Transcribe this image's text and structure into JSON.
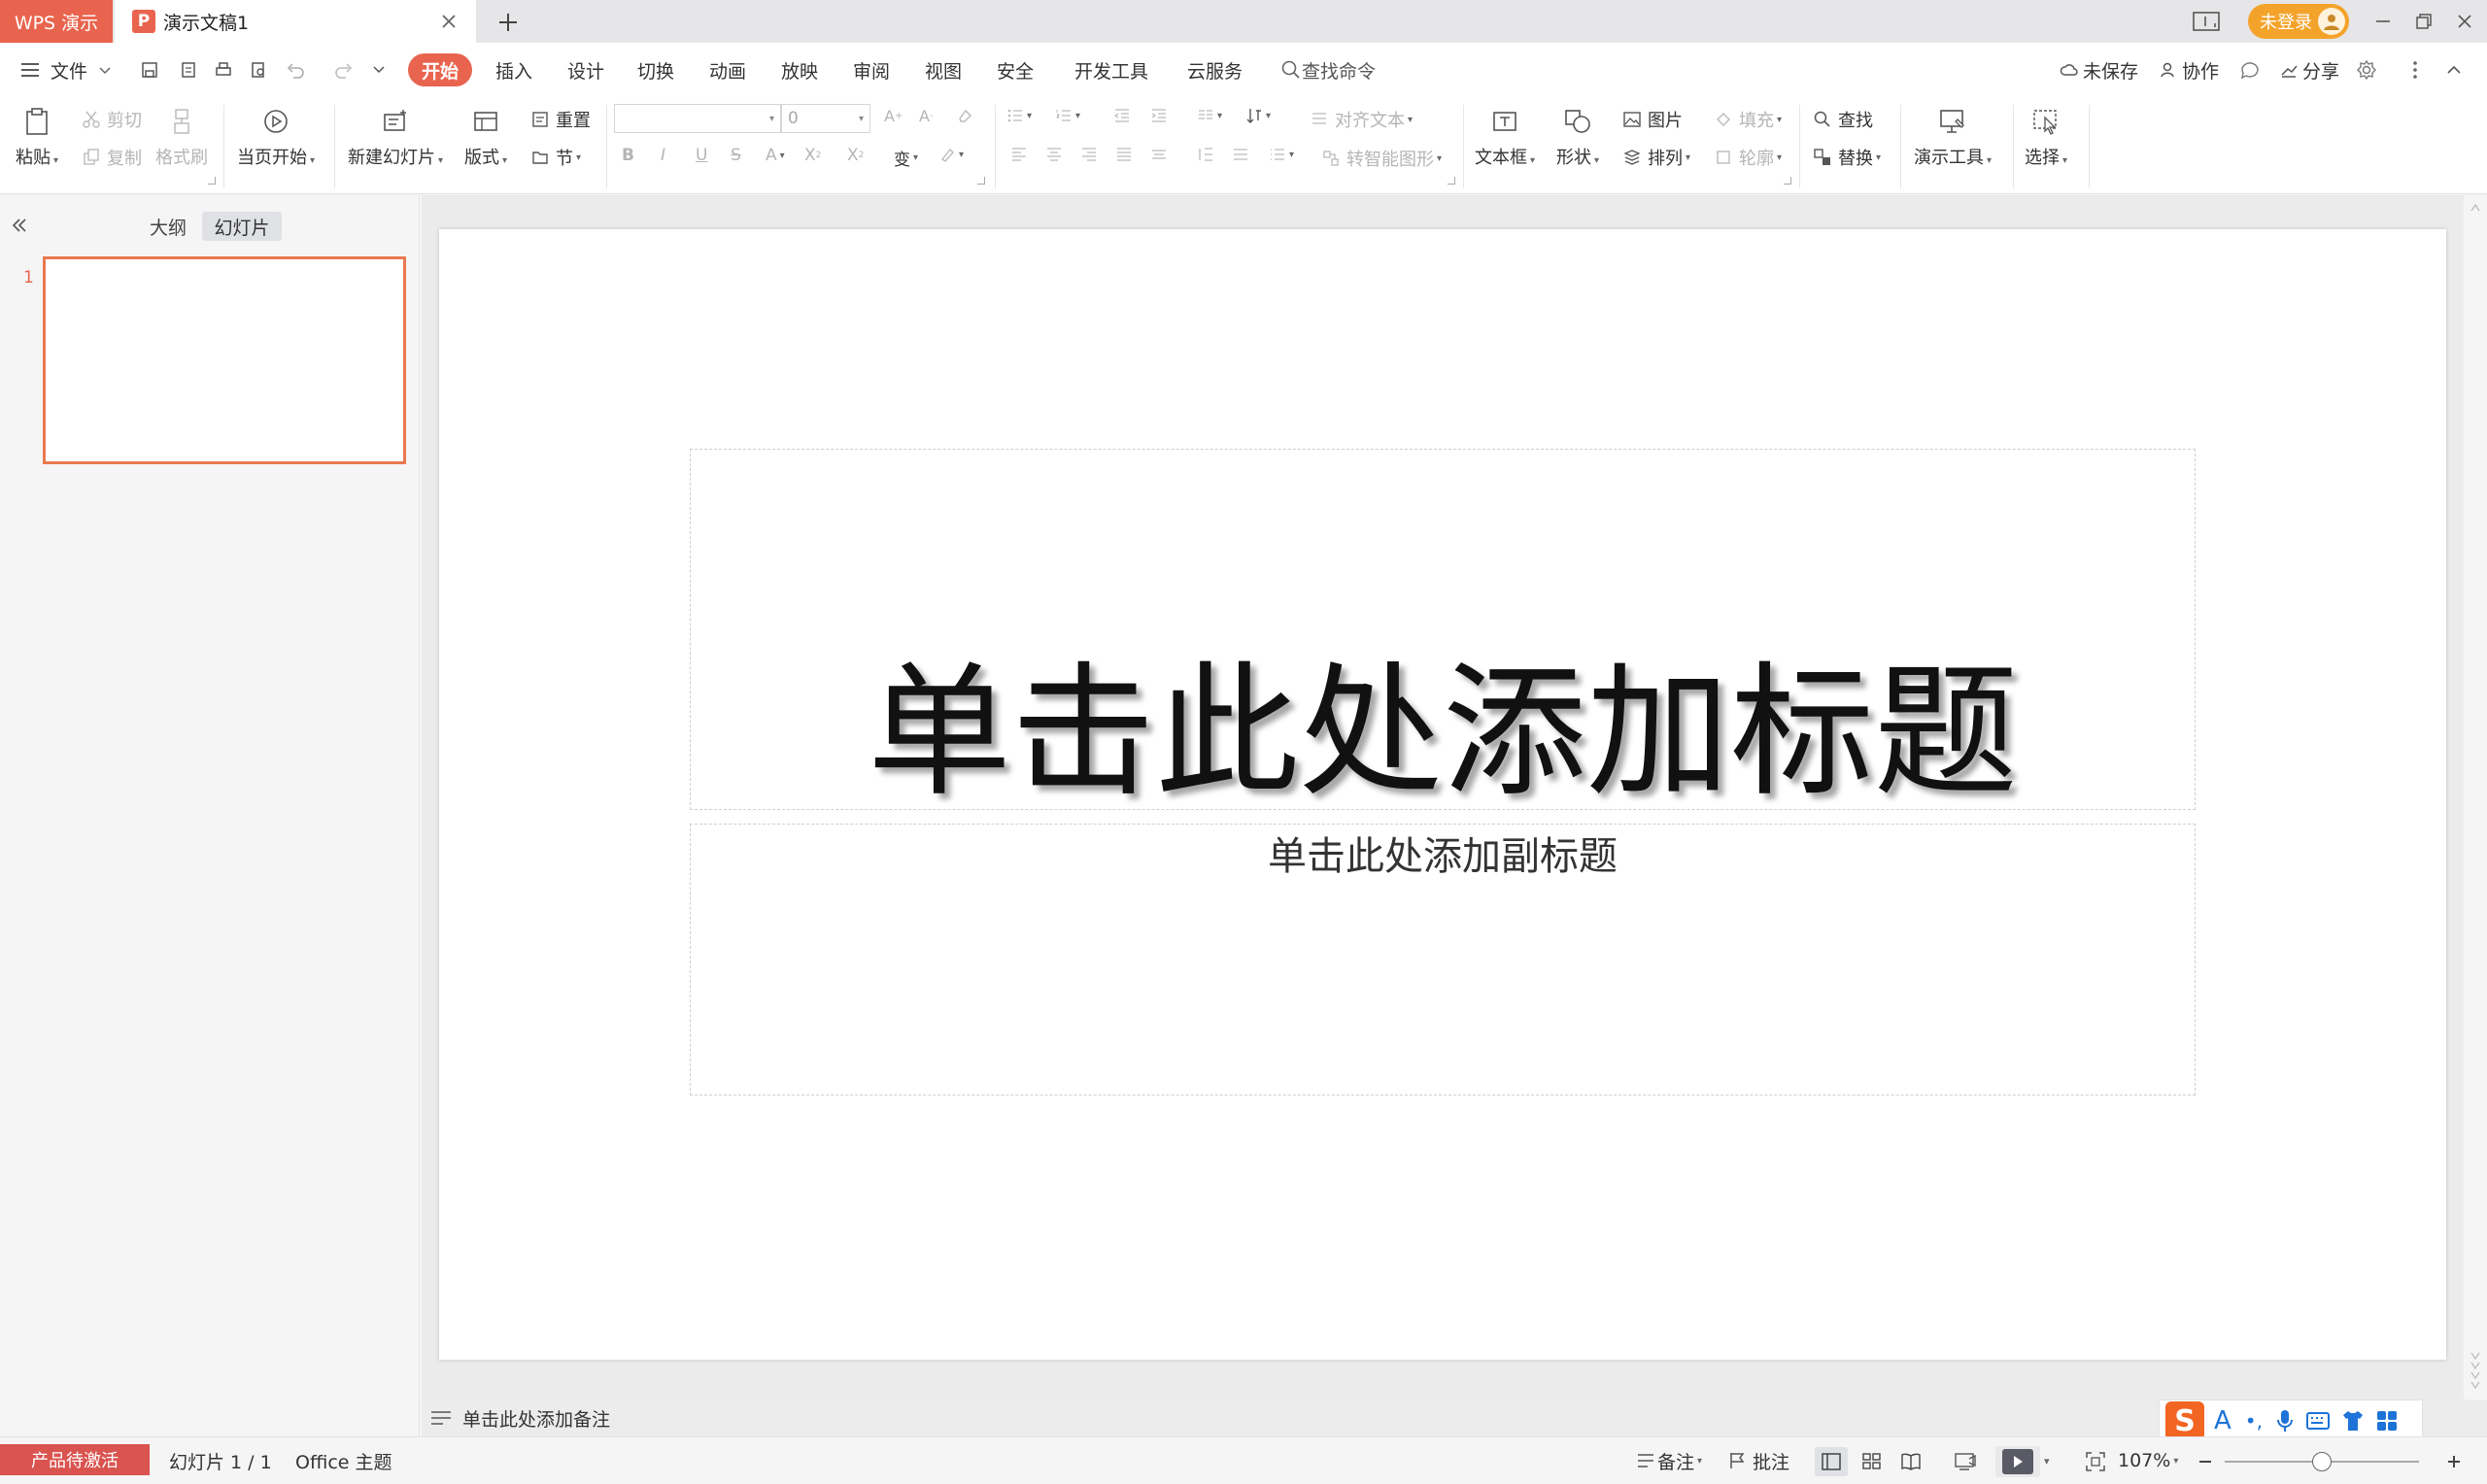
{
  "titlebar": {
    "app_tab": "WPS 演示",
    "doc_tab": "演示文稿1",
    "login": "未登录",
    "colors": {
      "accent": "#e9644e",
      "login": "#f4a32a",
      "titlebar_bg": "#e6e6e8"
    }
  },
  "menubar": {
    "file": "文件",
    "tabs": [
      "开始",
      "插入",
      "设计",
      "切换",
      "动画",
      "放映",
      "审阅",
      "视图",
      "安全",
      "开发工具",
      "云服务"
    ],
    "search": "查找命令",
    "unsaved": "未保存",
    "collab": "协作",
    "share": "分享"
  },
  "ribbon": {
    "paste": "粘贴",
    "cut": "剪切",
    "copy": "复制",
    "format_painter": "格式刷",
    "from_current": "当页开始",
    "new_slide": "新建幻灯片",
    "layout": "版式",
    "reset": "重置",
    "section": "节",
    "font_size": "0",
    "align_text": "对齐文本",
    "smartart": "转智能图形",
    "textbox": "文本框",
    "shape": "形状",
    "picture": "图片",
    "arrange": "排列",
    "fill": "填充",
    "outline": "轮廓",
    "find": "查找",
    "replace": "替换",
    "present_tools": "演示工具",
    "select": "选择"
  },
  "leftpanel": {
    "tab_outline": "大纲",
    "tab_slides": "幻灯片",
    "slide_number": "1"
  },
  "slide": {
    "title_placeholder": "单击此处添加标题",
    "subtitle_placeholder": "单击此处添加副标题"
  },
  "notes": {
    "placeholder": "单击此处添加备注"
  },
  "statusbar": {
    "activate": "产品待激活",
    "slide_count": "幻灯片 1 / 1",
    "theme": "Office 主题",
    "notes": "备注",
    "comments": "批注",
    "zoom": "107%",
    "zoom_fraction": 0.5
  },
  "ime": {
    "logo": "S",
    "letter": "A"
  }
}
